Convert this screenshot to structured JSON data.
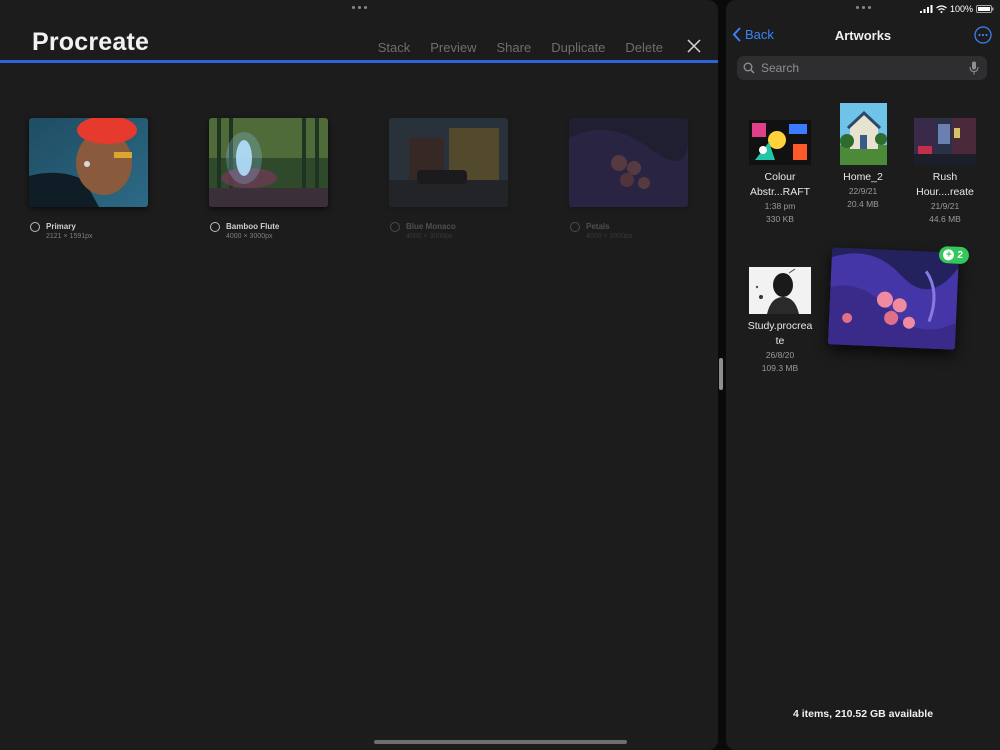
{
  "procreate": {
    "title": "Procreate",
    "toolbar": [
      "Stack",
      "Preview",
      "Share",
      "Duplicate",
      "Delete"
    ],
    "accent_color": "#2f63d7",
    "artworks": [
      {
        "name": "Primary",
        "dims": "2121 × 1591px",
        "dimmed": false
      },
      {
        "name": "Bamboo Flute",
        "dims": "4000 × 3000px",
        "dimmed": false
      },
      {
        "name": "Blue Monaco",
        "dims": "4000 × 3000px",
        "dimmed": true
      },
      {
        "name": "Petals",
        "dims": "4000 × 3000px",
        "dimmed": true
      }
    ]
  },
  "files": {
    "status": {
      "battery": "100%"
    },
    "back_label": "Back",
    "title": "Artworks",
    "search_placeholder": "Search",
    "items": [
      {
        "name_line1": "Colour",
        "name_line2": "Abstr...RAFT",
        "date": "1:38 pm",
        "size": "330 KB"
      },
      {
        "name_line1": "Home_2",
        "name_line2": "",
        "date": "22/9/21",
        "size": "20.4 MB"
      },
      {
        "name_line1": "Rush",
        "name_line2": "Hour....reate",
        "date": "21/9/21",
        "size": "44.6 MB"
      },
      {
        "name_line1": "Study.procrea",
        "name_line2": "te",
        "date": "26/8/20",
        "size": "109.3 MB"
      }
    ],
    "drag_badge_count": "2",
    "footer": "4 items, 210.52 GB available"
  }
}
